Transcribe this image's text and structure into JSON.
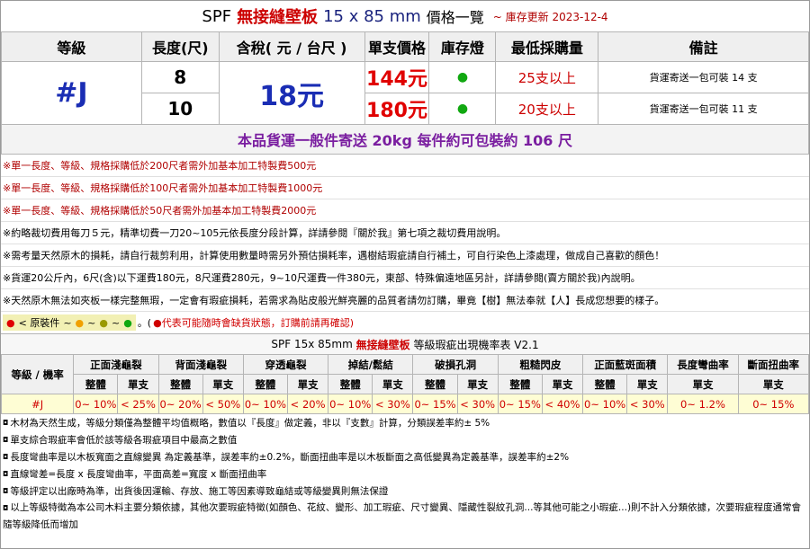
{
  "title": {
    "prefix": "SPF",
    "product": "無接縫壁板",
    "size": "15 x 85 mm",
    "suffix": "價格一覽",
    "update": "~ 庫存更新 2023-12-4"
  },
  "headers": [
    "等級",
    "長度(尺)",
    "含稅( 元 / 台尺 )",
    "單支價格",
    "庫存燈",
    "最低採購量",
    "備註"
  ],
  "grade": "#J",
  "price_per_ft": "18元",
  "rows": [
    {
      "length": "8",
      "single_price": "144元",
      "stock": "●",
      "min_qty": "25支以上",
      "note": "貨運寄送一包可裝 14 支"
    },
    {
      "length": "10",
      "single_price": "180元",
      "stock": "●",
      "min_qty": "20支以上",
      "note": "貨運寄送一包可裝 11 支"
    }
  ],
  "shipping": "本品貨運一般件寄送 20kg 每件約可包裝約 106 尺",
  "rules": [
    "※單一長度、等級、規格採購低於200尺者需外加基本加工特製費500元",
    "※單一長度、等級、規格採購低於100尺者需外加基本加工特製費1000元",
    "※單一長度、等級、規格採購低於50尺者需外加基本加工特製費2000元",
    "※約略裁切費用每刀５元，精準切費一刀20~105元依長度分段計算，詳請參閱『關於我』第七項之裁切費用說明。",
    "※需考量天然原木的損耗，請自行裁剪利用，計算使用數量時需另外預估損耗率，遇樹結瑕疵請自行補土，可自行染色上漆處理，做成自己喜歡的顏色！",
    "※貨運20公斤內，6尺(含)以下運費180元，8尺運費280元，9~10尺運費一件380元，東部、特殊偏遠地區另計，詳請參閱(賣方關於我)內說明。",
    "※天然原木無法如夾板一樣完整無瑕，一定會有瑕疵損耗，若需求為貼皮般光鮮亮麗的品質者請勿訂購，畢竟【樹】無法奉就【人】長成您想要的樣子。"
  ],
  "legend": {
    "label": "< 原裝件",
    "sep": "~",
    "end": "。(",
    "warning": "●代表可能隨時會缺貨狀態，訂購前請再確認)"
  },
  "defect_title": {
    "prefix": "SPF 15x 85mm",
    "product": "無接縫壁板",
    "suffix": "等級瑕疵出現機率表 V2.1"
  },
  "defect_table": {
    "corner": "等級 / 機率",
    "groups": [
      "正面淺龜裂",
      "背面淺龜裂",
      "穿透龜裂",
      "掉結/鬆結",
      "破損孔洞",
      "粗糙閃皮",
      "正面藍斑面積",
      "長度彎曲率",
      "斷面扭曲率"
    ],
    "sub_whole": "整體",
    "sub_single": "單支",
    "grade": "#J",
    "values": [
      "0~ 10%",
      "< 25%",
      "0~ 20%",
      "< 50%",
      "0~ 10%",
      "< 20%",
      "0~ 10%",
      "< 30%",
      "0~ 15%",
      "< 30%",
      "0~ 15%",
      "< 40%",
      "0~ 10%",
      "< 30%",
      "0~ 1.2%",
      "0~ 15%"
    ]
  },
  "footnotes": [
    "木材為天然生成，等級分類僅為整體平均值概略，數值以『長度』做定義，非以『支數』計算，分類誤差率約± 5%",
    "單支綜合瑕疵率會低於該等級各瑕疵項目中最高之數值",
    "長度彎曲率是以木板寬面之直線變異 為定義基準，誤差率約±0.2%，斷面扭曲率是以木板斷面之高低變異為定義基準，誤差率約±2%",
    "直線彎差=長度 x 長度彎曲率，平面高差=寬度 x 斷面扭曲率",
    "等級評定以出廠時為準，出貨後因運輸、存放、施工等因素導致龜結或等級變異則無法保證",
    "以上等級特徵為本公司木料主要分類依據，其他次要瑕疵特徵(如顏色、花紋、變形、加工瑕疵、尺寸變異、隱藏性裂紋孔洞...等其他可能之小瑕疵...)則不計入分類依據，次要瑕疵程度通常會隨等級降低而增加"
  ]
}
